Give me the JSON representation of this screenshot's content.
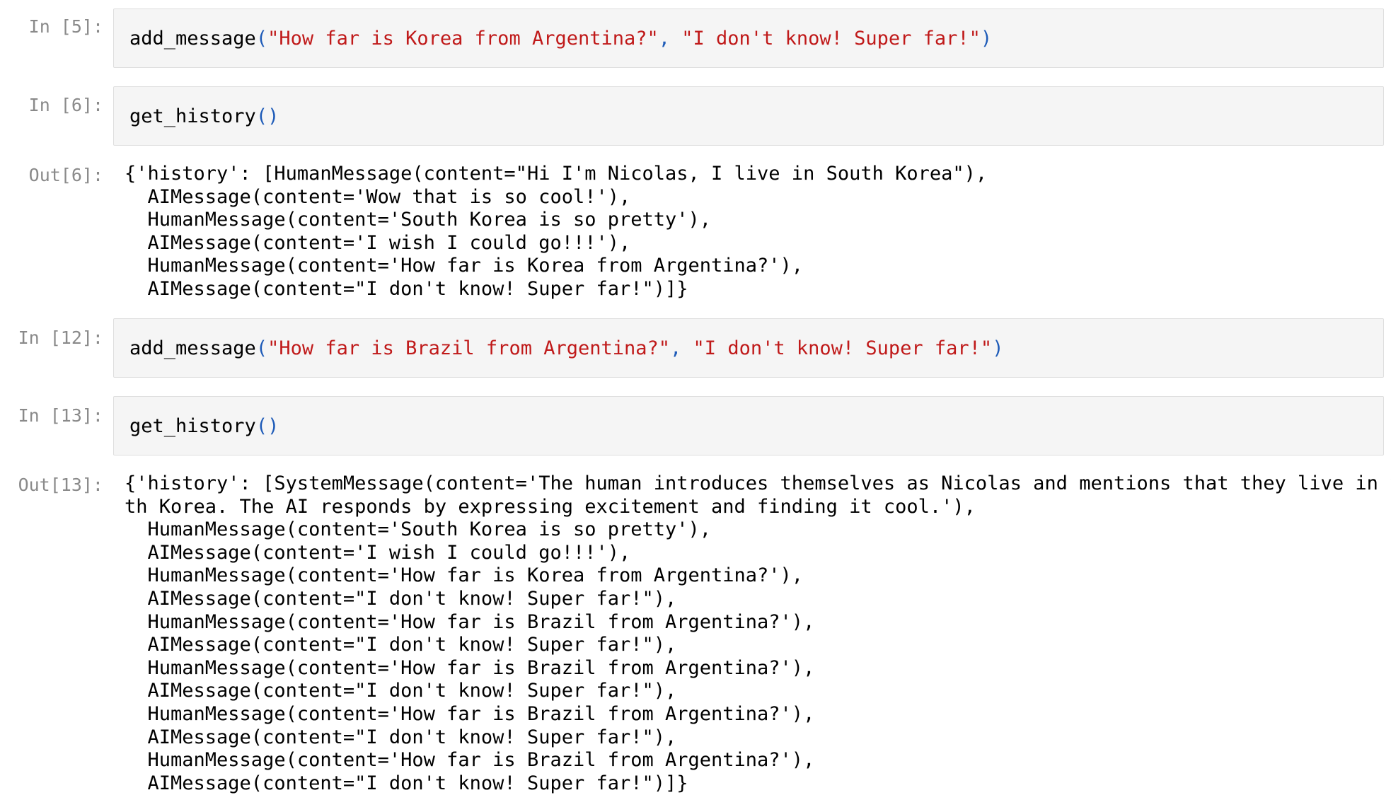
{
  "cells": {
    "c5": {
      "prompt": "In [5]:",
      "fn": "add_message",
      "open": "(",
      "arg1": "\"How far is Korea from Argentina?\"",
      "sep": ", ",
      "arg2": "\"I don't know! Super far!\"",
      "close": ")"
    },
    "c6": {
      "prompt": "In [6]:",
      "fn": "get_history",
      "parens": "()"
    },
    "o6": {
      "prompt": "Out[6]:",
      "lines": [
        "{'history': [HumanMessage(content=\"Hi I'm Nicolas, I live in South Korea\"),",
        "  AIMessage(content='Wow that is so cool!'),",
        "  HumanMessage(content='South Korea is so pretty'),",
        "  AIMessage(content='I wish I could go!!!'),",
        "  HumanMessage(content='How far is Korea from Argentina?'),",
        "  AIMessage(content=\"I don't know! Super far!\")]}"
      ]
    },
    "c12": {
      "prompt": "In [12]:",
      "fn": "add_message",
      "open": "(",
      "arg1": "\"How far is Brazil from Argentina?\"",
      "sep": ", ",
      "arg2": "\"I don't know! Super far!\"",
      "close": ")"
    },
    "c13": {
      "prompt": "In [13]:",
      "fn": "get_history",
      "parens": "()"
    },
    "o13": {
      "prompt": "Out[13]:",
      "lines": [
        "{'history': [SystemMessage(content='The human introduces themselves as Nicolas and mentions that they live in Sou",
        "th Korea. The AI responds by expressing excitement and finding it cool.'),",
        "  HumanMessage(content='South Korea is so pretty'),",
        "  AIMessage(content='I wish I could go!!!'),",
        "  HumanMessage(content='How far is Korea from Argentina?'),",
        "  AIMessage(content=\"I don't know! Super far!\"),",
        "  HumanMessage(content='How far is Brazil from Argentina?'),",
        "  AIMessage(content=\"I don't know! Super far!\"),",
        "  HumanMessage(content='How far is Brazil from Argentina?'),",
        "  AIMessage(content=\"I don't know! Super far!\"),",
        "  HumanMessage(content='How far is Brazil from Argentina?'),",
        "  AIMessage(content=\"I don't know! Super far!\"),",
        "  HumanMessage(content='How far is Brazil from Argentina?'),",
        "  AIMessage(content=\"I don't know! Super far!\")]}"
      ]
    }
  },
  "colors": {
    "string": "#c01a1a",
    "punct": "#1e5bb8",
    "prompt": "#8a8a8a",
    "cell_bg": "#f5f5f5"
  }
}
